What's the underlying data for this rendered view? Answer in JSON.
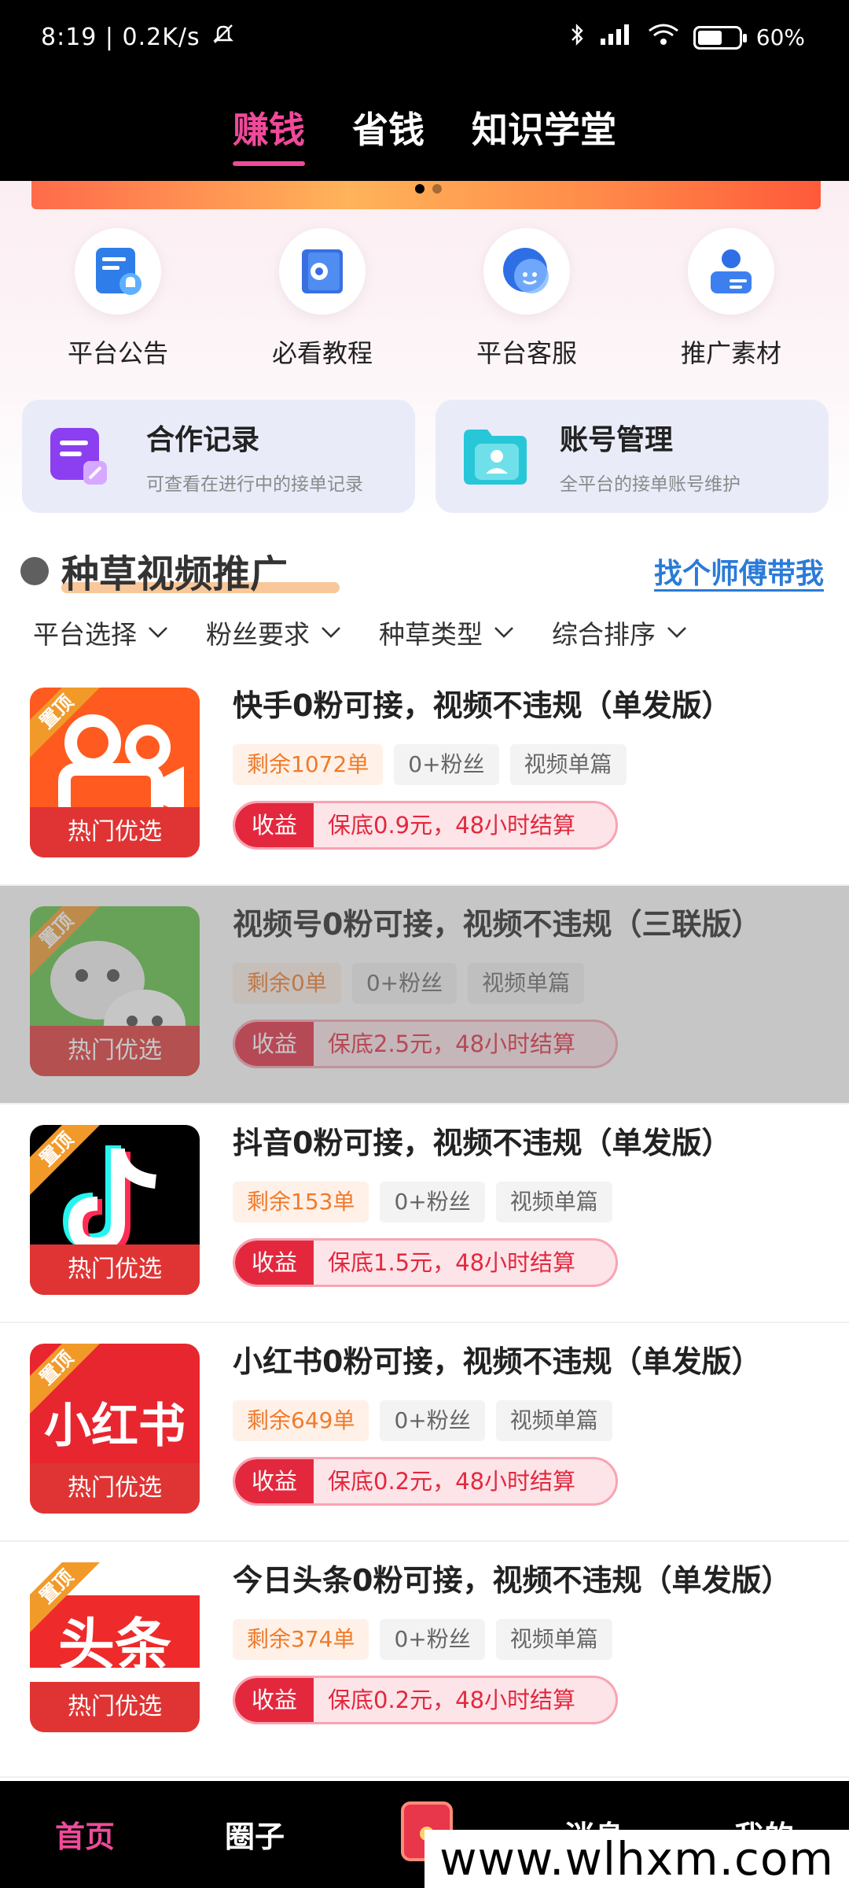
{
  "status": {
    "time_speed": "8:19 | 0.2K/s",
    "battery": "60%",
    "battery_level": 0.6
  },
  "top_tabs": [
    {
      "label": "赚钱",
      "active": true
    },
    {
      "label": "省钱",
      "active": false
    },
    {
      "label": "知识学堂",
      "active": false
    }
  ],
  "quick_links": [
    {
      "label": "平台公告",
      "icon": "notice-icon"
    },
    {
      "label": "必看教程",
      "icon": "tutorial-icon"
    },
    {
      "label": "平台客服",
      "icon": "service-icon"
    },
    {
      "label": "推广素材",
      "icon": "material-icon"
    }
  ],
  "cards": [
    {
      "title": "合作记录",
      "subtitle": "可查看在进行中的接单记录",
      "icon": "record-icon"
    },
    {
      "title": "账号管理",
      "subtitle": "全平台的接单账号维护",
      "icon": "account-icon"
    }
  ],
  "section": {
    "title": "种草视频推广",
    "link": "找个师傅带我"
  },
  "filters": [
    "平台选择",
    "粉丝要求",
    "种草类型",
    "综合排序"
  ],
  "tasks": [
    {
      "title": "快手0粉可接，视频不违规（单发版）",
      "remaining": "剩余1072单",
      "fans": "0+粉丝",
      "type": "视频单篇",
      "earn_label": "收益",
      "earn": "保底0.9元，48小时结算",
      "hot": "热门优选",
      "badge": "置顶",
      "platform": "kuaishou",
      "disabled": false
    },
    {
      "title": "视频号0粉可接，视频不违规（三联版）",
      "remaining": "剩余0单",
      "fans": "0+粉丝",
      "type": "视频单篇",
      "earn_label": "收益",
      "earn": "保底2.5元，48小时结算",
      "hot": "热门优选",
      "badge": "置顶",
      "platform": "wechat-channels",
      "disabled": true
    },
    {
      "title": "抖音0粉可接，视频不违规（单发版）",
      "remaining": "剩余153单",
      "fans": "0+粉丝",
      "type": "视频单篇",
      "earn_label": "收益",
      "earn": "保底1.5元，48小时结算",
      "hot": "热门优选",
      "badge": "置顶",
      "platform": "douyin",
      "disabled": false
    },
    {
      "title": "小红书0粉可接，视频不违规（单发版）",
      "remaining": "剩余649单",
      "fans": "0+粉丝",
      "type": "视频单篇",
      "earn_label": "收益",
      "earn": "保底0.2元，48小时结算",
      "hot": "热门优选",
      "badge": "置顶",
      "platform": "xiaohongshu",
      "logo_text": "小红书",
      "disabled": false
    },
    {
      "title": "今日头条0粉可接，视频不违规（单发版）",
      "remaining": "剩余374单",
      "fans": "0+粉丝",
      "type": "视频单篇",
      "earn_label": "收益",
      "earn": "保底0.2元，48小时结算",
      "hot": "热门优选",
      "badge": "置顶",
      "platform": "toutiao",
      "logo_text": "头条",
      "disabled": false
    }
  ],
  "bottom_nav": [
    {
      "label": "首页",
      "active": true
    },
    {
      "label": "圈子",
      "active": false
    },
    {
      "label": "消息",
      "active": false
    },
    {
      "label": "我的",
      "active": false
    }
  ],
  "watermark": "www.wlhxm.com",
  "colors": {
    "accent": "#f04a9a",
    "hot_red": "#e03434",
    "link_blue": "#2a7bd8",
    "badge_orange": "#f19a2a"
  }
}
